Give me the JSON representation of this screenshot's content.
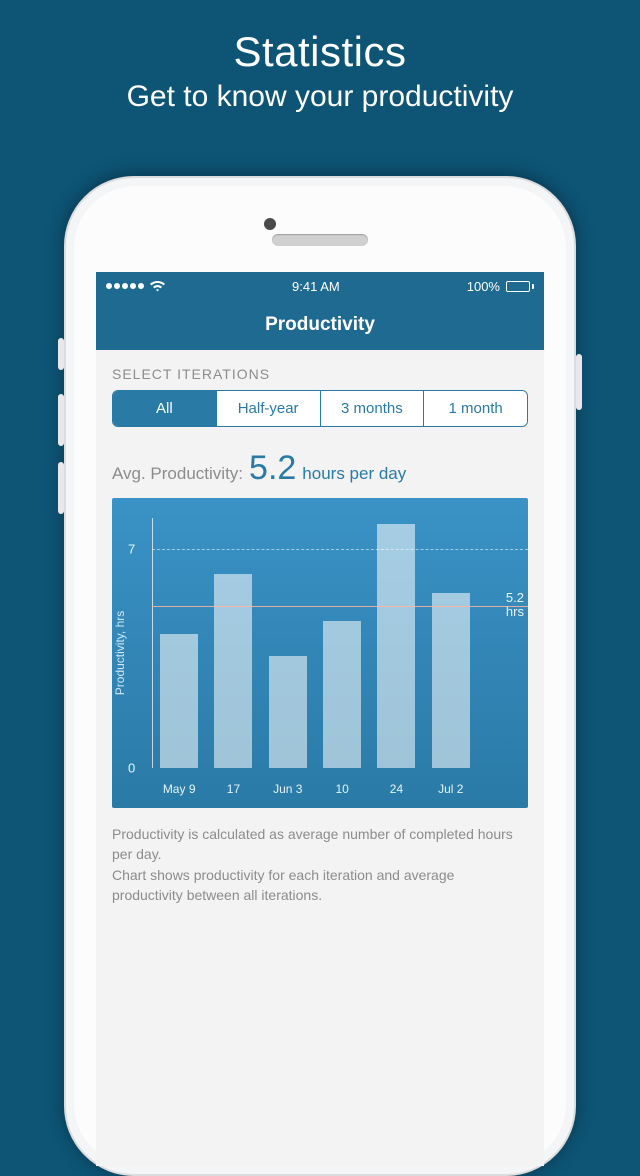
{
  "marketing": {
    "title": "Statistics",
    "subtitle": "Get to know your productivity"
  },
  "statusbar": {
    "time": "9:41 AM",
    "battery_text": "100%"
  },
  "navbar": {
    "title": "Productivity"
  },
  "iterations": {
    "label": "SELECT ITERATIONS",
    "selected": "All",
    "options": {
      "all": "All",
      "half_year": "Half-year",
      "three_months": "3 months",
      "one_month": "1 month"
    }
  },
  "avg": {
    "label": "Avg. Productivity:",
    "value": "5.2",
    "unit": "hours per day"
  },
  "chart_data": {
    "type": "bar",
    "categories": [
      "May 9",
      "17",
      "Jun 3",
      "10",
      "24",
      "Jul 2"
    ],
    "values": [
      4.3,
      6.2,
      3.6,
      4.7,
      7.8,
      5.6
    ],
    "ylabel": "Productivity, hrs",
    "ylim": [
      0,
      8
    ],
    "yticks": [
      0,
      7
    ],
    "avg_line": {
      "value": 5.2,
      "label_value": "5.2",
      "label_unit": "hrs"
    }
  },
  "footer": {
    "line1": "Productivity is calculated as average number of completed hours per day.",
    "line2": "Chart shows productivity for each iteration and average productivity between all iterations."
  }
}
